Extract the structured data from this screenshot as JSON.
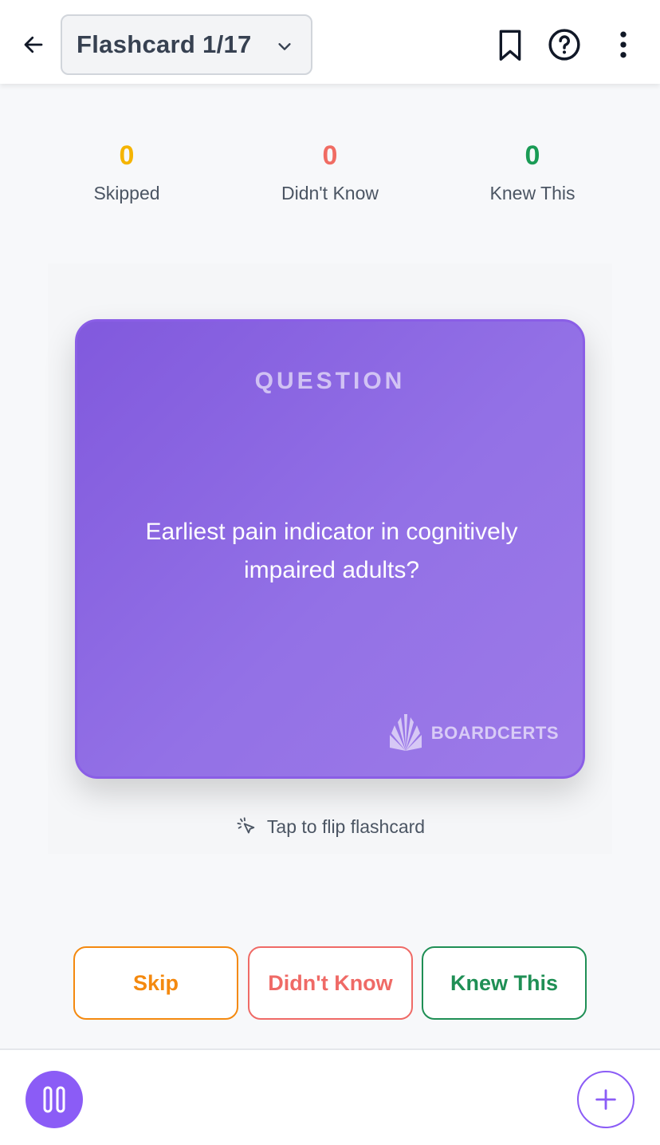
{
  "header": {
    "title": "Flashcard 1/17",
    "icons": [
      "back-arrow-icon",
      "chevron-down-icon",
      "bookmark-icon",
      "help-icon",
      "more-vertical-icon"
    ]
  },
  "stats": [
    {
      "value": "0",
      "label": "Skipped",
      "color": "#f5b400"
    },
    {
      "value": "0",
      "label": "Didn't Know",
      "color": "#f06c63"
    },
    {
      "value": "0",
      "label": "Knew This",
      "color": "#1a9b55"
    }
  ],
  "card": {
    "label": "QUESTION",
    "question": "Earliest pain indicator in cognitively impaired adults?",
    "brand": "BOARDCERTS",
    "color": "#8b5cf6"
  },
  "flip_hint": "Tap to flip flashcard",
  "actions": {
    "skip": {
      "label": "Skip",
      "color": "#f4890f"
    },
    "didnt_know": {
      "label": "Didn't Know",
      "color": "#ef6a66"
    },
    "knew_this": {
      "label": "Knew This",
      "color": "#1f8f55"
    }
  },
  "bottom": {
    "icons": [
      "pause-icon",
      "plus-icon"
    ]
  }
}
